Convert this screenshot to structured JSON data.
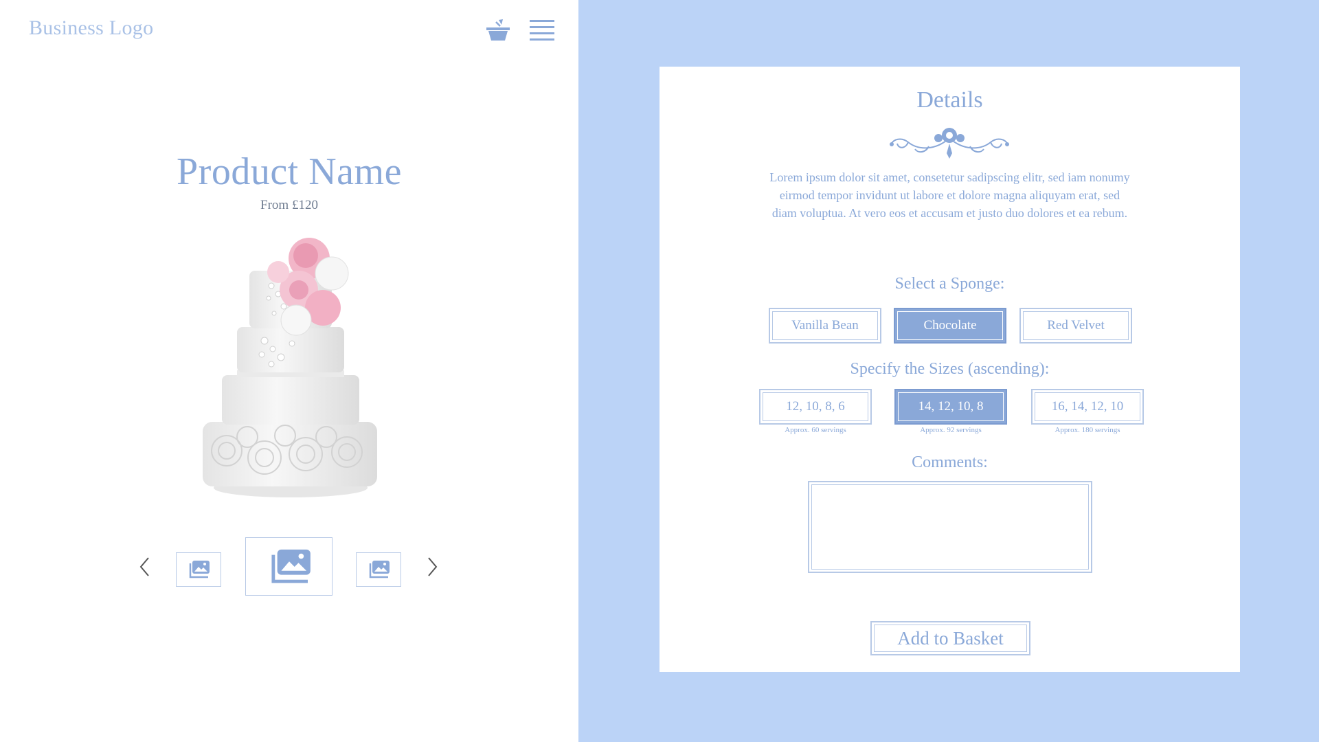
{
  "header": {
    "logo_text": "Business Logo",
    "basket_icon": "basket-icon",
    "menu_icon": "hamburger-menu-icon"
  },
  "product": {
    "name": "Product Name",
    "price": "From £120",
    "image_alt": "three-tier white wedding cake with pink flowers"
  },
  "gallery": {
    "prev_icon": "chevron-left-icon",
    "next_icon": "chevron-right-icon",
    "thumbnail_icon": "image-gallery-icon",
    "thumbnails": 3,
    "active_index": 1
  },
  "details": {
    "title": "Details",
    "description": "Lorem ipsum dolor sit amet, consetetur sadipscing elitr, sed iam nonumy eirmod tempor invidunt ut labore et dolore magna aliquyam erat, sed diam voluptua. At vero eos et accusam et justo duo dolores et ea rebum."
  },
  "sponge": {
    "label": "Select a Sponge:",
    "options": [
      "Vanilla Bean",
      "Chocolate",
      "Red Velvet"
    ],
    "selected": "Chocolate"
  },
  "sizes": {
    "label": "Specify the Sizes (ascending):",
    "options": [
      {
        "label": "12, 10, 8, 6",
        "servings": "Approx. 60 servings"
      },
      {
        "label": "14, 12, 10, 8",
        "servings": "Approx. 92 servings"
      },
      {
        "label": "16, 14, 12, 10",
        "servings": "Approx. 180 servings"
      }
    ],
    "selected": "14, 12, 10, 8"
  },
  "comments": {
    "label": "Comments:",
    "value": "",
    "placeholder": ""
  },
  "actions": {
    "add_to_basket": "Add to Basket"
  },
  "colors": {
    "accent": "#8aa8d8",
    "panel_bg": "#bbd3f7",
    "border": "#b7c9e6",
    "price_text": "#6f7c90"
  }
}
